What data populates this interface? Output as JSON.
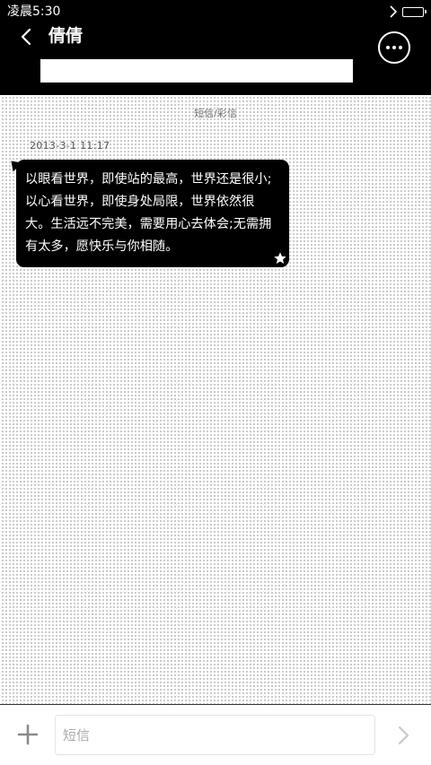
{
  "status_bar": {
    "time": "凌晨5:30",
    "location_icon": "location-arrow-icon",
    "battery_icon": "battery-icon"
  },
  "header": {
    "back_icon": "chevron-left-icon",
    "contact_name": "倩倩",
    "more_icon": "more-horizontal-icon",
    "recipient_value": ""
  },
  "conversation": {
    "type_label": "短信/彩信",
    "messages": [
      {
        "timestamp": "2013-3-1 11:17",
        "text": "以眼看世界，即使站的最高，世界还是很小;以心看世界，即使身处局限，世界依然很大。生活远不完美，需要用心去体会;无需拥有太多，愿快乐与你相随。",
        "starred_icon": "star-icon"
      }
    ]
  },
  "composer": {
    "add_icon": "plus-icon",
    "input_placeholder": "短信",
    "send_icon": "chevron-right-icon"
  },
  "colors": {
    "header_bg": "#000000",
    "bubble_bg": "#000000",
    "bubble_text": "#ffffff",
    "page_bg": "#ffffff"
  }
}
